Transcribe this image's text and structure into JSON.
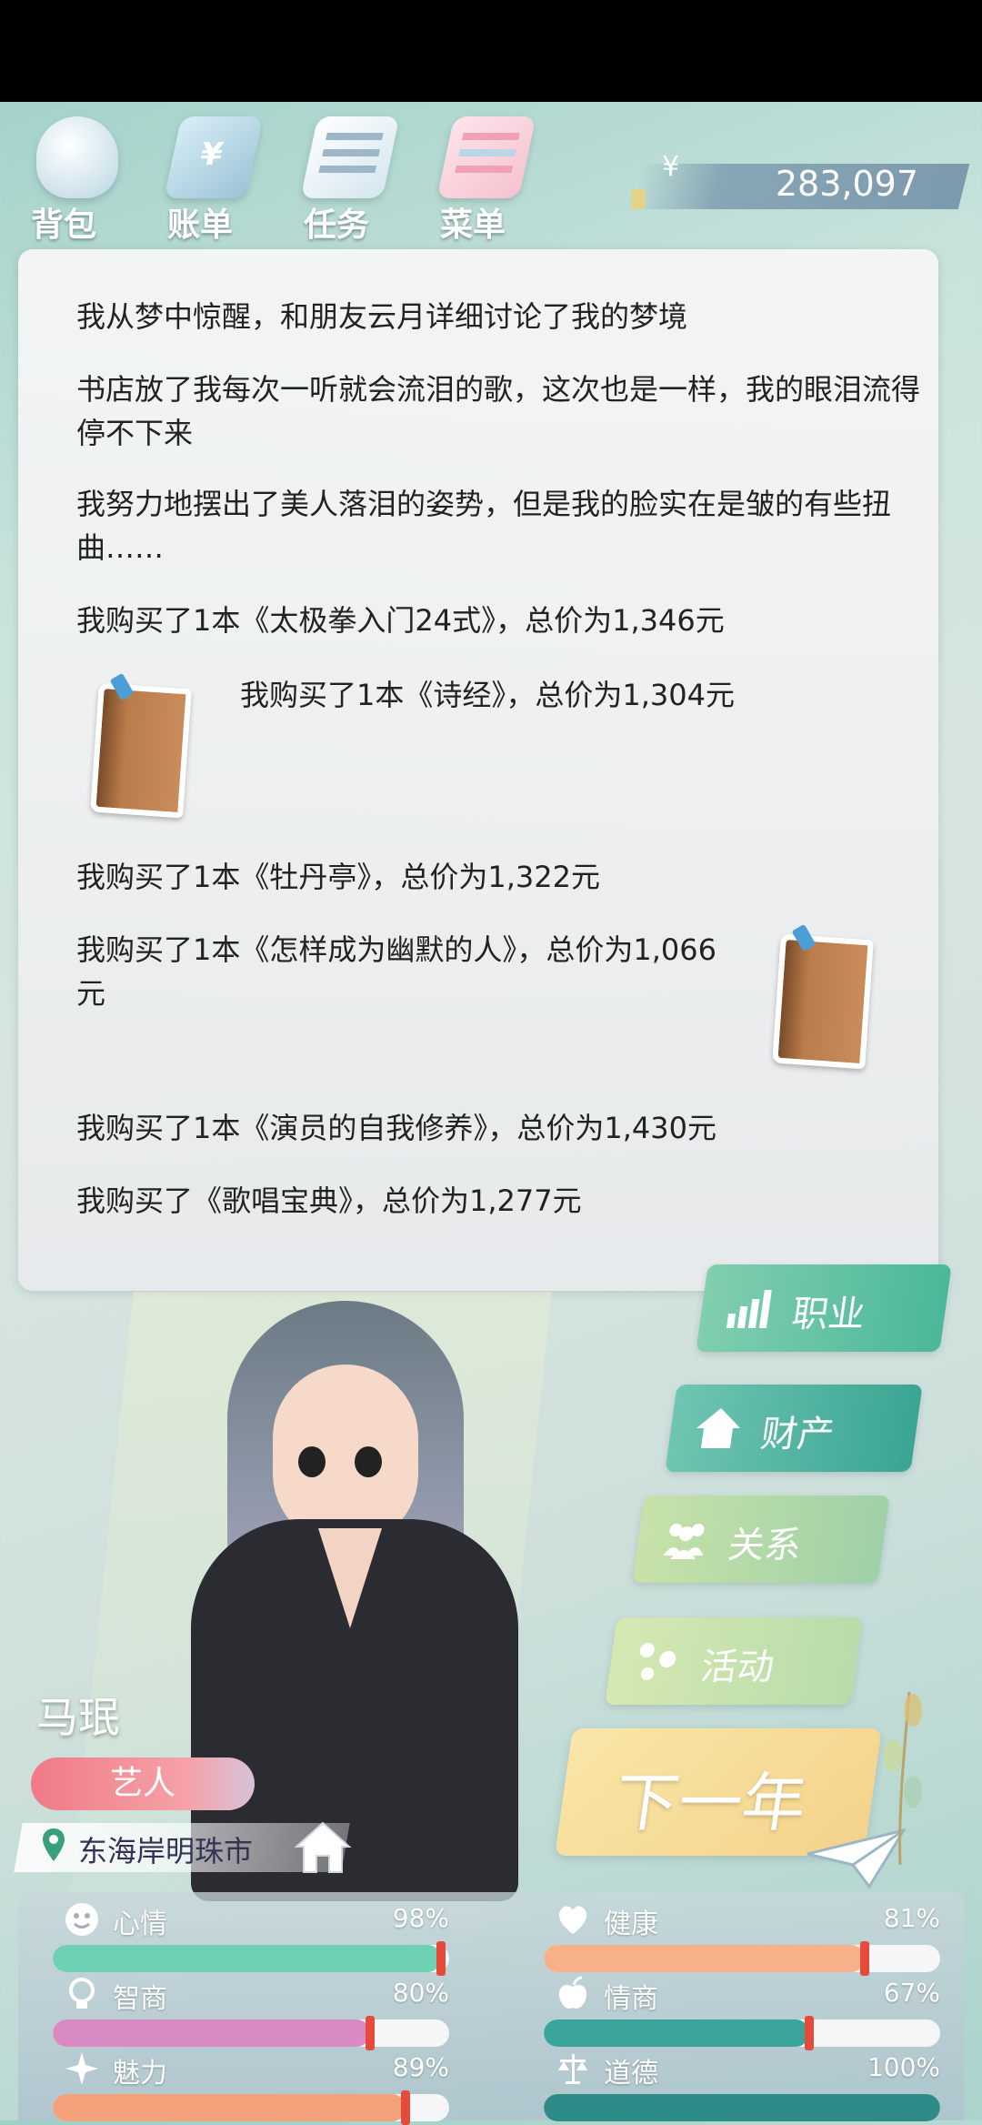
{
  "header": {
    "nav": [
      {
        "label": "背包",
        "icon": "bag-icon"
      },
      {
        "label": "账单",
        "icon": "bill-icon"
      },
      {
        "label": "任务",
        "icon": "task-icon"
      },
      {
        "label": "菜单",
        "icon": "menu-icon"
      }
    ],
    "currency_symbol": "¥",
    "money": "283,097"
  },
  "events": [
    "我从梦中惊醒，和朋友云月详细讨论了我的梦境",
    "书店放了我每次一听就会流泪的歌，这次也是一样，我的眼泪流得停不下来",
    "我努力地摆出了美人落泪的姿势，但是我的脸实在是皱的有些扭曲……",
    "我购买了1本《太极拳入门24式》，总价为1,346元",
    "我购买了1本《诗经》，总价为1,304元",
    "我购买了1本《牡丹亭》，总价为1,322元",
    "我购买了1本《怎样成为幽默的人》，总价为1,066元",
    "我购买了1本《演员的自我修养》，总价为1,430元",
    "我购买了《歌唱宝典》，总价为1,277元"
  ],
  "character": {
    "name": "马珉",
    "job": "艺人",
    "location": "东海岸明珠市"
  },
  "side_buttons": {
    "career": "职业",
    "assets": "财产",
    "relation": "关系",
    "activity": "活动",
    "next_year": "下一年"
  },
  "stats": [
    {
      "name": "心情",
      "value": "98%",
      "level": 0.98,
      "icon": "smile-icon",
      "color": "#6fd1b4"
    },
    {
      "name": "健康",
      "value": "81%",
      "level": 0.81,
      "icon": "heart-icon",
      "color": "#f7b08a"
    },
    {
      "name": "智商",
      "value": "80%",
      "level": 0.8,
      "icon": "bulb-icon",
      "color": "#d98ac2"
    },
    {
      "name": "情商",
      "value": "67%",
      "level": 0.67,
      "icon": "apple-icon",
      "color": "#3aa49a"
    },
    {
      "name": "魅力",
      "value": "89%",
      "level": 0.89,
      "icon": "sparkle-icon",
      "color": "#f3a27c"
    },
    {
      "name": "道德",
      "value": "100%",
      "level": 1.0,
      "icon": "scale-icon",
      "color": "#2f8b87"
    }
  ],
  "colors": {
    "career_btn": "#4bb79a",
    "next_year_btn": "#f4d28a",
    "job_badge": "#f07a86"
  }
}
